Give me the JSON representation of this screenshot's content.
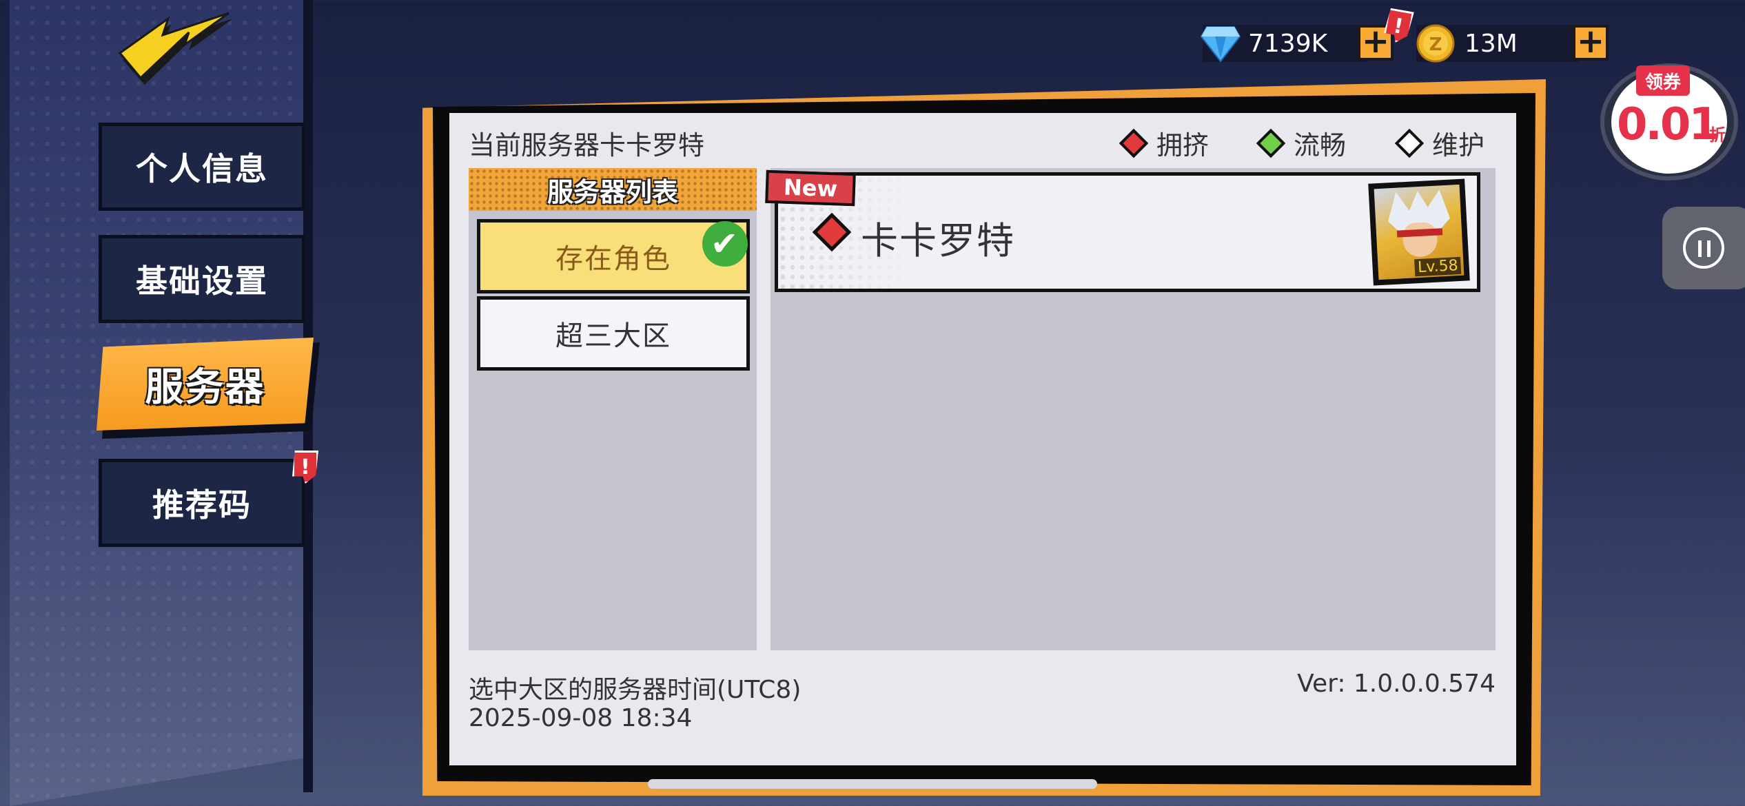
{
  "sidebar": {
    "back_icon": "lightning-back-icon",
    "items": [
      {
        "label": "个人信息",
        "active": false
      },
      {
        "label": "基础设置",
        "active": false
      },
      {
        "label": "服务器",
        "active": true
      },
      {
        "label": "推荐码",
        "active": false,
        "alert": "!"
      }
    ]
  },
  "topbar": {
    "gems": {
      "value": "7139K",
      "icon": "diamond-gem-icon",
      "alert": "!"
    },
    "coins": {
      "value": "13M",
      "icon": "gold-coin-icon"
    },
    "plus_label": "+"
  },
  "coupon": {
    "tag": "领券",
    "value": "0.01",
    "suffix": "折"
  },
  "panel": {
    "current_server": "当前服务器卡卡罗特",
    "legend": [
      {
        "label": "拥挤",
        "color": "#e03a3a"
      },
      {
        "label": "流畅",
        "color": "#6fd04a"
      },
      {
        "label": "维护",
        "color": "#ffffff"
      }
    ],
    "list_header": "服务器列表",
    "regions": [
      {
        "label": "存在角色",
        "selected": true
      },
      {
        "label": "超三大区",
        "selected": false
      }
    ],
    "servers": [
      {
        "tag": "New",
        "name": "卡卡罗特",
        "status": "crowded",
        "status_color": "#e03a3a",
        "level": "Lv.58"
      }
    ],
    "time_label": "选中大区的服务器时间(UTC8)",
    "time_value": "2025-09-08 18:34",
    "version": "Ver: 1.0.0.0.574"
  }
}
